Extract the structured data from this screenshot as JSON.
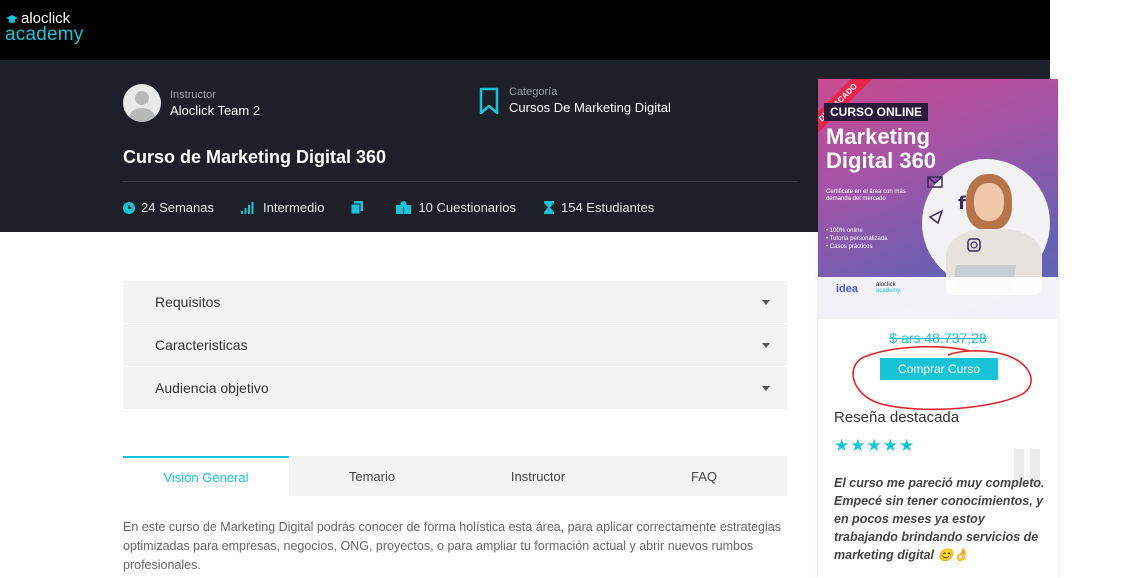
{
  "logo": {
    "line1": "aloclick",
    "line2": "academy"
  },
  "course": {
    "instructor_label": "Instructor",
    "instructor_name": "Aloclick Team 2",
    "category_label": "Categoría",
    "category_name": "Cursos De Marketing Digital",
    "title": "Curso de Marketing Digital 360",
    "stats": {
      "duration": "24 Semanas",
      "level": "Intermedio",
      "quizzes": "10 Cuestionarios",
      "students": "154 Estudiantes"
    }
  },
  "promo": {
    "ribbon": "DESTACADO",
    "tag": "CURSO ONLINE",
    "title_line1": "Marketing",
    "title_line2": "Digital 360",
    "subtitle": "Certificate en el área con más demanda del mercado",
    "bullets": [
      "100% online",
      "Tutoría personalizada",
      "Casos prácticos"
    ],
    "logo_idea": "idea",
    "logo_mini_1": "aloclick",
    "logo_mini_2": "academy"
  },
  "pricing": {
    "price": "$ ars 48.737,28",
    "buy_label": "Comprar Curso"
  },
  "review": {
    "heading": "Reseña destacada",
    "stars": "★★★★★",
    "rating": 5,
    "text": "El curso me pareció muy completo. Empecé sin tener conocimientos, y en pocos meses ya estoy trabajando brindando servicios de marketing digital 😊👌"
  },
  "accordion": [
    "Requisitos",
    "Caracteristicas",
    "Audiencia objetivo"
  ],
  "tabs": [
    "Visión General",
    "Temario",
    "Instructor",
    "FAQ"
  ],
  "description": "En este curso de Marketing Digital podrás conocer de forma holística esta área, para aplicar correctamente estrategias optimizadas para empresas, negocios, ONG, proyectos, o para ampliar tu formación actual y abrir nuevos rumbos profesionales.",
  "colors": {
    "accent": "#18c3d8",
    "hero_bg": "#1d2029",
    "topbar_bg": "#000000",
    "annotation": "#e0242c"
  }
}
